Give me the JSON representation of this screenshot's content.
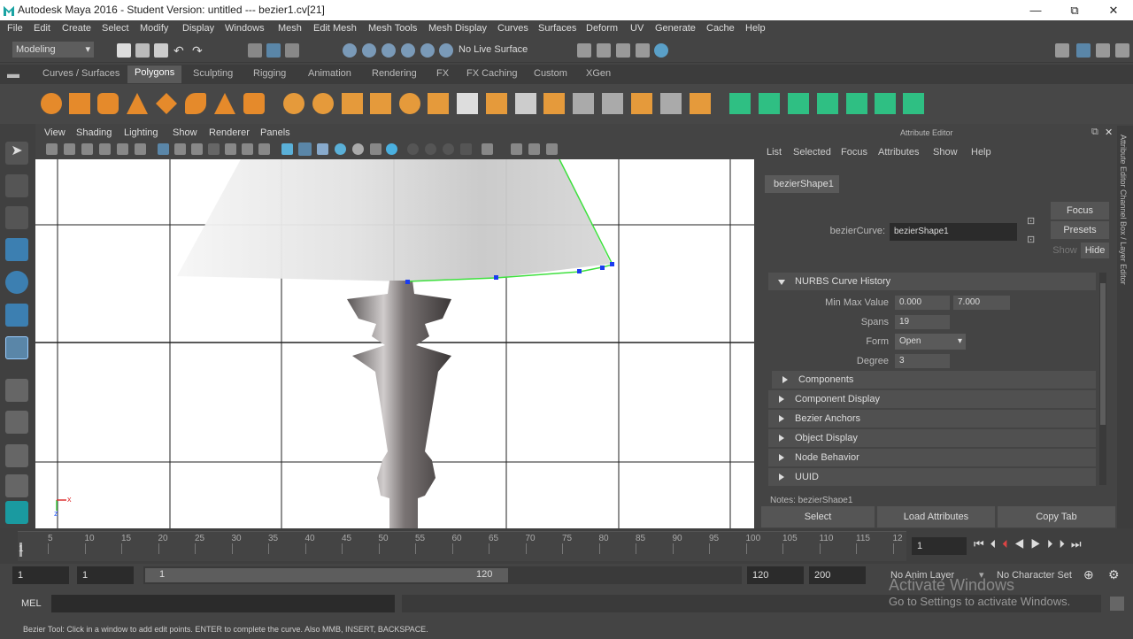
{
  "title_bar": {
    "title": "Autodesk Maya 2016 - Student Version: untitled   ---   bezier1.cv[21]",
    "minimize": "—",
    "restore": "⧉",
    "close": "✕"
  },
  "menubar": [
    "File",
    "Edit",
    "Create",
    "Select",
    "Modify",
    "Display",
    "Windows",
    "Mesh",
    "Edit Mesh",
    "Mesh Tools",
    "Mesh Display",
    "Curves",
    "Surfaces",
    "Deform",
    "UV",
    "Generate",
    "Cache",
    "Help"
  ],
  "status_line": {
    "mode": "Modeling",
    "live_surface": "No Live Surface"
  },
  "shelf_tabs": [
    "Curves / Surfaces",
    "Polygons",
    "Sculpting",
    "Rigging",
    "Animation",
    "Rendering",
    "FX",
    "FX Caching",
    "Custom",
    "XGen"
  ],
  "shelf_active": "Polygons",
  "viewport": {
    "menus": [
      "View",
      "Shading",
      "Lighting",
      "Show",
      "Renderer",
      "Panels"
    ],
    "axis_x": "x",
    "axis_z": "z"
  },
  "attribute_editor": {
    "title": "Attribute Editor",
    "menus": [
      "List",
      "Selected",
      "Focus",
      "Attributes",
      "Show",
      "Help"
    ],
    "node_tab": "bezierShape1",
    "node_label": "bezierCurve:",
    "node_value": "bezierShape1",
    "focus_btn": "Focus",
    "presets_btn": "Presets",
    "show_btn": "Show",
    "hide_btn": "Hide",
    "section": "NURBS Curve History",
    "fields": {
      "min_max_label": "Min Max Value",
      "min": "0.000",
      "max": "7.000",
      "spans_label": "Spans",
      "spans": "19",
      "form_label": "Form",
      "form": "Open",
      "degree_label": "Degree",
      "degree": "3"
    },
    "frames": [
      "Components",
      "Component Display",
      "Bezier Anchors",
      "Object Display",
      "Node Behavior",
      "UUID"
    ],
    "notes": "Notes: bezierShape1",
    "buttons": {
      "select": "Select",
      "load": "Load Attributes",
      "copy": "Copy Tab"
    },
    "side_tabs": "Attribute Editor   Channel Box / Layer Editor"
  },
  "time_slider": {
    "ticks": [
      "5",
      "10",
      "15",
      "20",
      "25",
      "30",
      "35",
      "40",
      "45",
      "50",
      "55",
      "60",
      "65",
      "70",
      "75",
      "80",
      "85",
      "90",
      "95",
      "100",
      "105",
      "110",
      "115",
      "12"
    ],
    "first": "1",
    "current": "1"
  },
  "range_slider": {
    "start": "1",
    "anim_start": "1",
    "range_start": "1",
    "range_end": "120",
    "end": "120",
    "anim_end": "200",
    "anim_layer": "No Anim Layer",
    "char_set": "No Character Set"
  },
  "command_line": {
    "label": "MEL"
  },
  "watermark": {
    "line1": "Activate Windows",
    "line2": "Go to Settings to activate Windows."
  },
  "help_line": "Bezier Tool: Click in a window to add edit points. ENTER to complete the curve. Also MMB, INSERT, BACKSPACE."
}
